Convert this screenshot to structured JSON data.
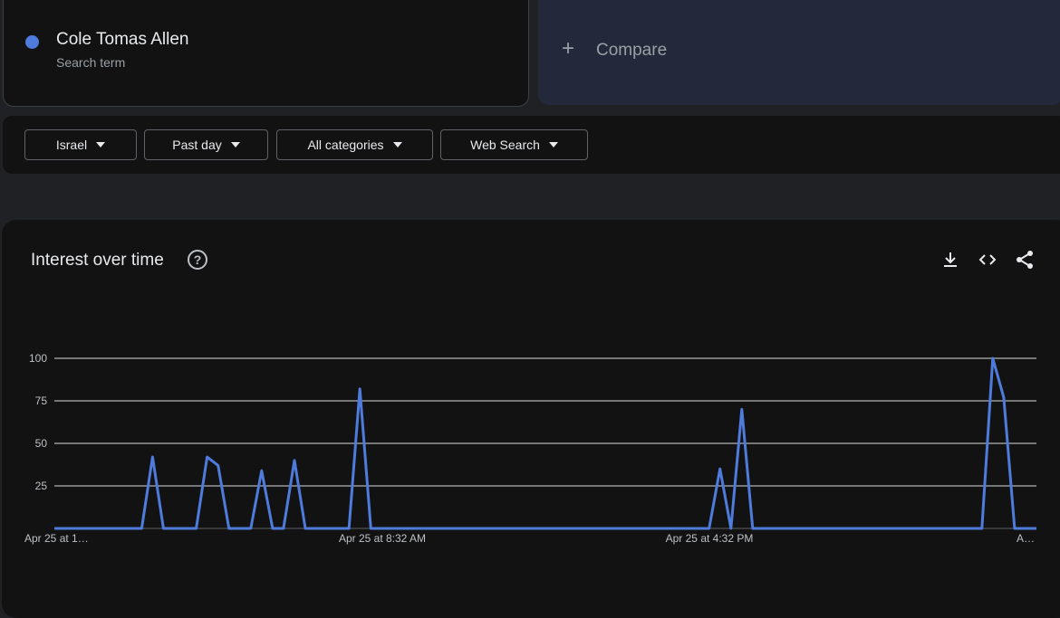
{
  "search_term": {
    "name": "Cole Tomas Allen",
    "subtitle": "Search term",
    "color": "#4e7bdc"
  },
  "compare": {
    "plus": "+",
    "label": "Compare"
  },
  "filters": {
    "region": "Israel",
    "time_range": "Past day",
    "category": "All categories",
    "search_type": "Web Search"
  },
  "chart_card": {
    "title": "Interest over time",
    "help_icon": "help-circle-icon",
    "tools": [
      "download-icon",
      "embed-code-icon",
      "share-icon"
    ]
  },
  "chart_data": {
    "type": "line",
    "title": "Interest over time",
    "xlabel": "",
    "ylabel": "",
    "ylim": [
      0,
      100
    ],
    "yticks": [
      25,
      50,
      75,
      100
    ],
    "xtick_labels": [
      "Apr 25 at 1…",
      "Apr 25 at 8:32 AM",
      "Apr 25 at 4:32 PM",
      "A…"
    ],
    "grid": true,
    "series": [
      {
        "color": "#4e7bdc",
        "values": [
          0,
          0,
          0,
          0,
          0,
          0,
          0,
          0,
          0,
          0,
          0,
          0,
          0,
          0,
          0,
          0,
          0,
          0,
          0,
          0,
          0,
          0,
          0,
          0,
          0,
          0,
          0,
          0,
          0,
          0,
          0,
          0,
          0,
          0,
          0,
          0,
          0,
          0,
          0,
          0,
          0,
          0,
          0,
          0,
          0,
          0,
          0,
          0,
          0,
          0,
          0,
          0,
          0,
          0,
          0,
          0,
          0,
          0,
          0,
          0,
          0,
          0,
          0,
          0,
          0,
          0,
          0,
          0,
          0,
          0,
          0,
          0,
          0,
          0,
          0,
          0,
          0,
          0,
          0,
          0,
          0,
          0,
          0,
          0,
          0,
          0,
          0,
          0,
          0,
          0,
          0,
          0,
          0,
          0,
          0,
          0,
          0,
          0,
          0,
          0,
          0,
          0,
          0,
          0,
          0,
          0,
          0,
          0,
          0,
          0,
          0,
          0,
          0,
          0,
          0,
          0,
          0,
          0,
          0,
          0,
          0,
          0,
          0,
          0,
          0,
          0,
          0,
          0,
          0,
          0,
          0,
          0,
          0,
          0,
          0,
          0,
          0,
          0,
          0,
          0,
          0,
          0,
          0,
          0,
          0,
          0,
          0,
          0,
          0,
          0,
          0,
          0,
          0,
          0,
          0,
          0,
          0,
          0,
          0,
          0,
          0,
          0,
          0,
          0,
          0,
          0,
          0,
          0,
          0,
          0,
          0,
          0,
          0,
          0
        ]
      }
    ],
    "spikes": [
      [
        9,
        42
      ],
      [
        14,
        42
      ],
      [
        15,
        37
      ],
      [
        19,
        34
      ],
      [
        22,
        40
      ],
      [
        28,
        82
      ],
      [
        61,
        35
      ],
      [
        63,
        70
      ],
      [
        86,
        100
      ],
      [
        87,
        77
      ]
    ],
    "points": 91
  }
}
